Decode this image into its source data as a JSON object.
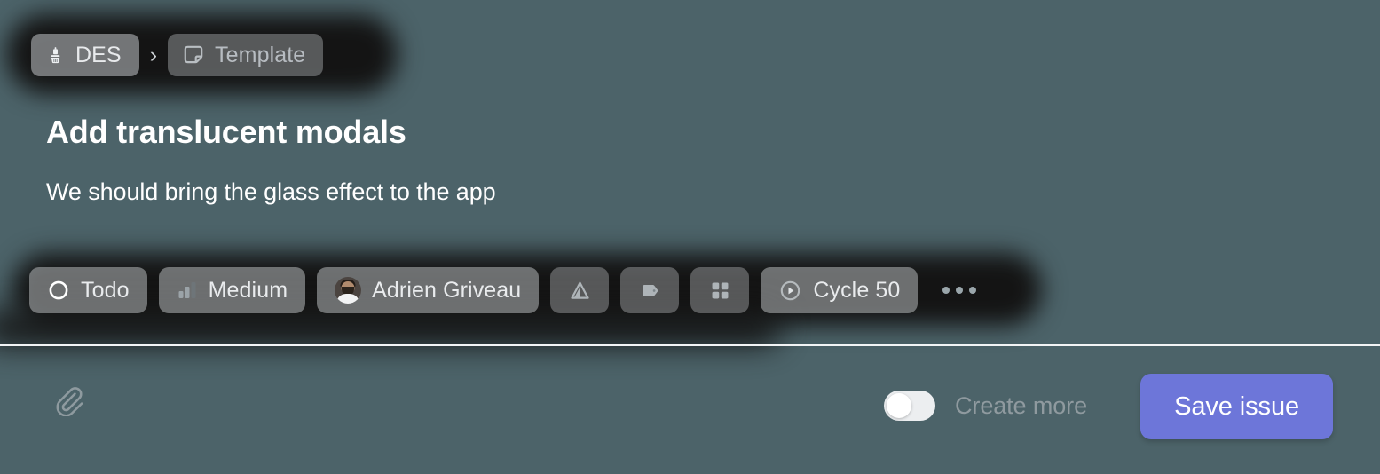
{
  "theme": {
    "background": "#4c6369",
    "chip_background": "#a8abad",
    "chip_text": "#e9ebed",
    "accent": "#6d76d9",
    "divider": "#f2f4f5",
    "muted_text": "#8f9a9f",
    "glow": "#141414"
  },
  "breadcrumb": {
    "items": [
      {
        "label": "DES",
        "icon": "paintbrush-icon",
        "dim": false
      },
      {
        "label": "Template",
        "icon": "template-icon",
        "dim": true
      }
    ],
    "separator": "›"
  },
  "issue": {
    "title": "Add translucent modals",
    "description": "We should bring the glass effect to the app"
  },
  "properties": {
    "chips": [
      {
        "label": "Todo",
        "icon": "status-todo-icon"
      },
      {
        "label": "Medium",
        "icon": "priority-medium-icon"
      },
      {
        "label": "Adrien Griveau",
        "icon": "assignee-avatar"
      },
      {
        "label": "",
        "icon": "project-triangle-icon"
      },
      {
        "label": "",
        "icon": "label-tag-icon"
      },
      {
        "label": "",
        "icon": "modules-grid-icon"
      },
      {
        "label": "Cycle 50",
        "icon": "cycle-play-icon"
      }
    ],
    "overflow_label": "…"
  },
  "footer": {
    "attach_icon": "paperclip-icon",
    "create_more_label": "Create more",
    "create_more_enabled": false,
    "save_label": "Save issue"
  }
}
